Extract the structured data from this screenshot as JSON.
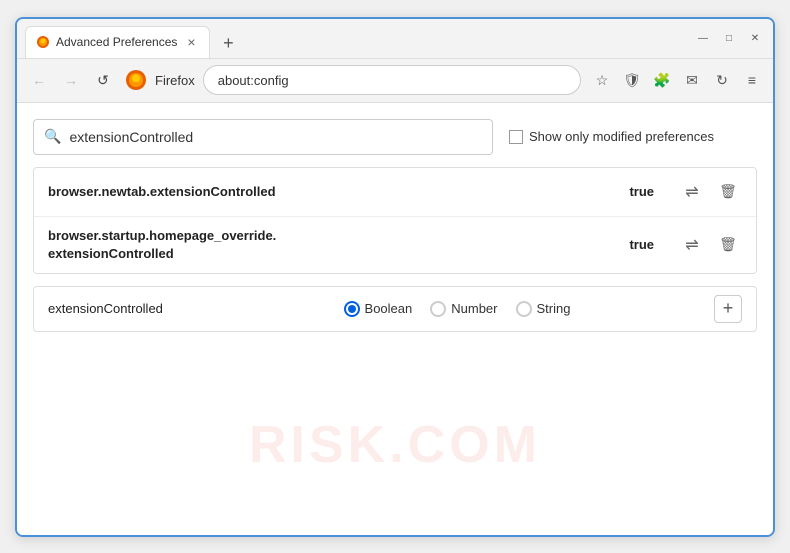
{
  "window": {
    "title": "Advanced Preferences",
    "tab_close": "×",
    "new_tab": "+",
    "win_minimize": "—",
    "win_maximize": "□",
    "win_close": "✕"
  },
  "nav": {
    "back": "←",
    "forward": "→",
    "refresh": "↺",
    "firefox_text": "Firefox",
    "url": "about:config",
    "bookmark_icon": "☆",
    "shield_icon": "🛡",
    "extension_icon": "🧩",
    "lock_icon": "✉",
    "sync_icon": "↻",
    "menu_icon": "≡"
  },
  "search": {
    "placeholder": "extensionControlled",
    "value": "extensionControlled",
    "checkbox_label": "Show only modified preferences"
  },
  "preferences": {
    "rows": [
      {
        "name": "browser.newtab.extensionControlled",
        "value": "true",
        "multiline": false
      },
      {
        "name": "browser.startup.homepage_override.\nextensionControlled",
        "name_line1": "browser.startup.homepage_override.",
        "name_line2": "extensionControlled",
        "value": "true",
        "multiline": true
      }
    ]
  },
  "new_pref": {
    "name": "extensionControlled",
    "types": [
      {
        "label": "Boolean",
        "selected": true
      },
      {
        "label": "Number",
        "selected": false
      },
      {
        "label": "String",
        "selected": false
      }
    ],
    "add_btn": "+"
  },
  "watermark": "RISK.COM"
}
